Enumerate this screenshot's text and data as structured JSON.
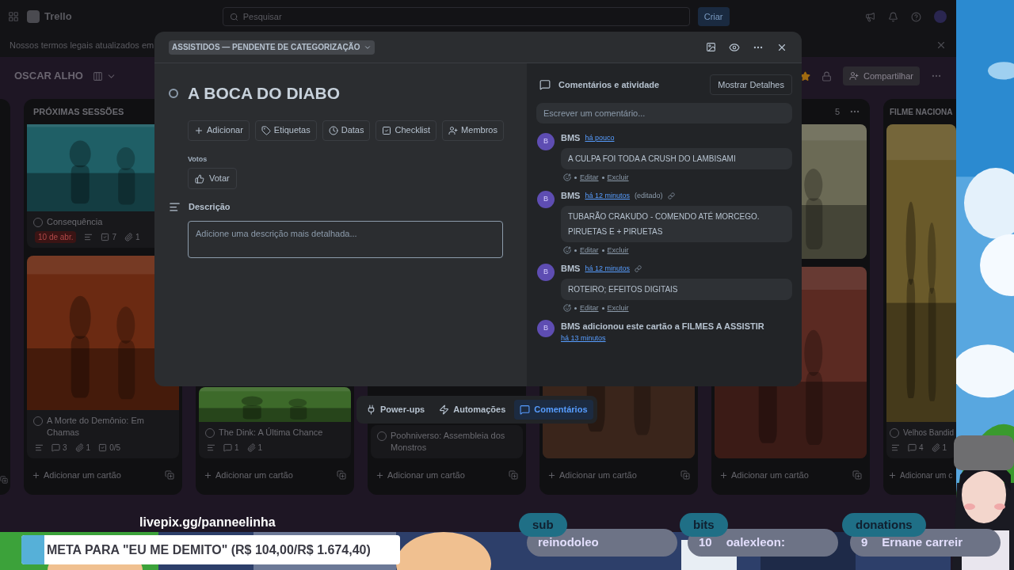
{
  "topbar": {
    "app_name": "Trello",
    "search": {
      "placeholder": "Pesquisar"
    },
    "create_button": "Criar"
  },
  "banner": {
    "text": "Nossos termos legais atualizados em"
  },
  "board": {
    "title": "OSCAR ALHO",
    "starred": true,
    "share_button": "Compartilhar"
  },
  "lists": [
    {
      "title": "PRÓXIMAS SESSÕES",
      "cards": [
        {
          "title": "Consequência",
          "badges": [
            {
              "kind": "due",
              "text": "10 de abr."
            },
            {
              "kind": "description"
            },
            {
              "kind": "checklist",
              "text": "7"
            },
            {
              "kind": "attachments",
              "text": "1"
            }
          ]
        },
        {
          "title": "A Morte do Demônio: Em Chamas",
          "badges": [
            {
              "kind": "description"
            },
            {
              "kind": "comments",
              "text": "3"
            },
            {
              "kind": "attachments",
              "text": "1"
            },
            {
              "kind": "checklist",
              "text": "0/5"
            }
          ]
        }
      ],
      "add_card": "Adicionar um cartão"
    },
    {
      "cards": [
        {
          "title": "The Dink: A Última Chance",
          "badges": [
            {
              "kind": "description"
            },
            {
              "kind": "comments",
              "text": "1"
            },
            {
              "kind": "attachments",
              "text": "1"
            }
          ]
        }
      ],
      "add_card": "Adicionar um cartão"
    },
    {
      "cards": [
        {
          "title": "Poohniverso: Assembleia dos Monstros"
        }
      ],
      "add_card": "Adicionar um cartão"
    },
    {
      "add_card": "Adicionar um cartão"
    },
    {
      "count": "5",
      "add_card": "Adicionar um cartão"
    },
    {
      "title": "FILME NACIONA",
      "cards": [
        {
          "title": "Velhos Bandid",
          "badges": [
            {
              "kind": "description"
            },
            {
              "kind": "comments",
              "text": "4"
            },
            {
              "kind": "attachments",
              "text": "1"
            }
          ]
        }
      ],
      "add_card": "Adicionar um c"
    }
  ],
  "quick_bar": [
    {
      "kind": "powerups",
      "label": "Power-ups",
      "selected": false
    },
    {
      "kind": "automation",
      "label": "Automações",
      "selected": false
    },
    {
      "kind": "comments",
      "label": "Comentários",
      "selected": true
    }
  ],
  "card_modal": {
    "list_name": "ASSISTIDOS — PENDENTE DE CATEGORIZAÇÃO",
    "title": "A BOCA DO DIABO",
    "actions": [
      {
        "kind": "add",
        "label": "Adicionar"
      },
      {
        "kind": "labels",
        "label": "Etiquetas"
      },
      {
        "kind": "dates",
        "label": "Datas"
      },
      {
        "kind": "checklist",
        "label": "Checklist"
      },
      {
        "kind": "members",
        "label": "Membros"
      }
    ],
    "votes_label": "Votos",
    "vote_button": "Votar",
    "description_title": "Descrição",
    "description": {
      "placeholder": "Adicione uma descrição mais detalhada..."
    },
    "activity_title": "Comentários e atividade",
    "details_button": "Mostrar Detalhes",
    "comment_field": {
      "placeholder": "Escrever um comentário..."
    },
    "comments": [
      {
        "avatar": "B",
        "author": "BMS",
        "time": "há pouco",
        "text": "A CULPA FOI TODA A CRUSH DO LAMBISAMI",
        "link": false,
        "edit": "Editar",
        "delete": "Excluir"
      },
      {
        "avatar": "B",
        "author": "BMS",
        "time": "há 12 minutos",
        "edited": "(editado)",
        "text": "TUBARÃO CRAKUDO - COMENDO ATÉ MORCEGO. PIRUETAS E + PIRUETAS",
        "link": true,
        "edit": "Editar",
        "delete": "Excluir"
      },
      {
        "avatar": "B",
        "author": "BMS",
        "time": "há 12 minutos",
        "text": "ROTEIRO; EFEITOS DIGITAIS",
        "link": true,
        "edit": "Editar",
        "delete": "Excluir"
      }
    ],
    "activity": {
      "avatar": "B",
      "text": "**BMS** adicionou este cartão a FILMES A ASSISTIR",
      "time": "há 13 minutos"
    }
  },
  "stream_overlay": {
    "link": "livepix.gg/panneelinha",
    "goal": {
      "text": "META PARA \"EU ME DEMITO\" (R$ 104,00/R$ 1.674,40)",
      "level": 0.06
    },
    "tickers": [
      {
        "label": "sub",
        "name": "reinodoleo"
      },
      {
        "label": "bits",
        "amount": "10",
        "name": "oalexleon:"
      },
      {
        "label": "donations",
        "amount": "9",
        "name": "Ernane carreir"
      }
    ]
  }
}
